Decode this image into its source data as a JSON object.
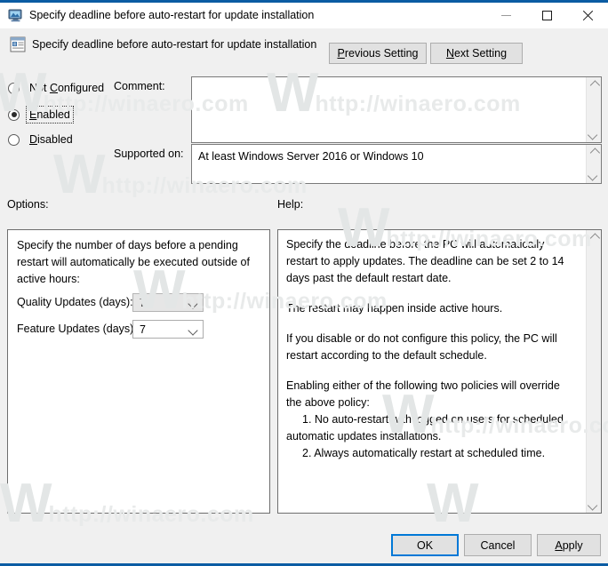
{
  "window": {
    "title": "Specify deadline before auto-restart for update installation",
    "icon": "computer-monitor-icon",
    "controls": {
      "minimize": "–",
      "maximize": "□",
      "close": "✕"
    }
  },
  "header": {
    "icon": "policy-setting-icon",
    "title": "Specify deadline before auto-restart for update installation",
    "previous_setting": "Previous Setting",
    "previous_accel": "P",
    "next_setting": "Next Setting",
    "next_accel": "N"
  },
  "state": {
    "options": [
      {
        "label": "Not Configured",
        "accel": "C",
        "selected": false,
        "focused": false
      },
      {
        "label": "Enabled",
        "accel": "E",
        "selected": true,
        "focused": true
      },
      {
        "label": "Disabled",
        "accel": "D",
        "selected": false,
        "focused": false
      }
    ]
  },
  "fields": {
    "comment_label": "Comment:",
    "comment_value": "",
    "comment_placeholder": "",
    "supported_label": "Supported on:",
    "supported_value": "At least Windows Server 2016 or Windows 10"
  },
  "options_panel": {
    "label": "Options:",
    "description": "Specify the number of days before a pending restart will automatically be executed outside of active hours:",
    "rows": [
      {
        "label": "Quality Updates (days):",
        "value": "7",
        "state": "hover"
      },
      {
        "label": "Feature Updates (days):",
        "value": "7",
        "state": "normal"
      }
    ]
  },
  "help_panel": {
    "label": "Help:",
    "paragraphs": [
      "Specify the deadline before the PC will automatically restart to apply updates. The deadline can be set 2 to 14 days past the default restart date.",
      "The restart may happen inside active hours.",
      "If you disable or do not configure this policy, the PC will restart according to the default schedule.",
      "Enabling either of the following two policies will override the above policy:"
    ],
    "list": [
      "1. No auto-restart with logged on users for scheduled automatic updates installations.",
      "2. Always automatically restart at scheduled time."
    ]
  },
  "footer": {
    "ok": "OK",
    "cancel": "Cancel",
    "apply": "Apply",
    "apply_accel": "A"
  },
  "watermark": {
    "logo": "W",
    "text": "http://winaero.com"
  },
  "colors": {
    "accent": "#0b5ca3",
    "dialog_bg": "#f0f0f0",
    "default_button_border": "#0078d7",
    "field_bg": "#ffffff"
  }
}
